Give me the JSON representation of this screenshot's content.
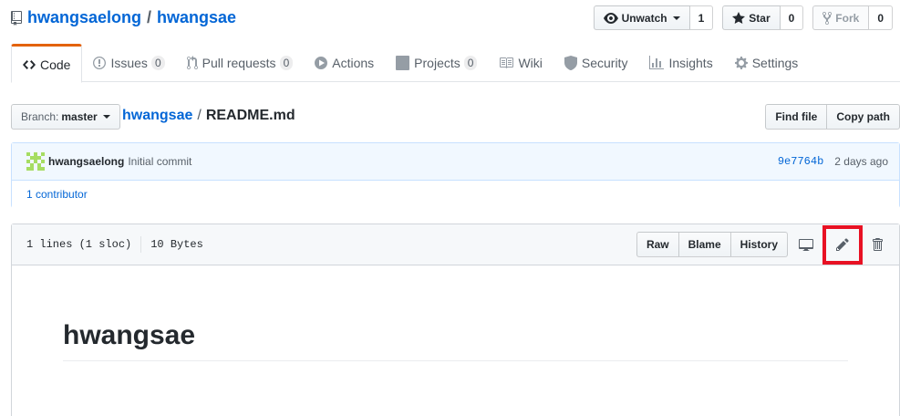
{
  "repo": {
    "owner": "hwangsaelong",
    "separator": "/",
    "name": "hwangsae"
  },
  "actions": {
    "watch": {
      "label": "Unwatch",
      "count": "1"
    },
    "star": {
      "label": "Star",
      "count": "0"
    },
    "fork": {
      "label": "Fork",
      "count": "0"
    }
  },
  "tabs": [
    {
      "label": "Code",
      "icon": "code-icon",
      "counter": null,
      "selected": true
    },
    {
      "label": "Issues",
      "icon": "issue-icon",
      "counter": "0"
    },
    {
      "label": "Pull requests",
      "icon": "pull-request-icon",
      "counter": "0"
    },
    {
      "label": "Actions",
      "icon": "play-icon",
      "counter": null
    },
    {
      "label": "Projects",
      "icon": "project-icon",
      "counter": "0"
    },
    {
      "label": "Wiki",
      "icon": "book-icon",
      "counter": null
    },
    {
      "label": "Security",
      "icon": "shield-icon",
      "counter": null
    },
    {
      "label": "Insights",
      "icon": "graph-icon",
      "counter": null
    },
    {
      "label": "Settings",
      "icon": "gear-icon",
      "counter": null
    }
  ],
  "file_nav": {
    "branch_prefix": "Branch:",
    "branch": "master",
    "breadcrumb_repo": "hwangsae",
    "breadcrumb_sep": "/",
    "breadcrumb_file": "README.md",
    "find_file": "Find file",
    "copy_path": "Copy path"
  },
  "commit": {
    "author": "hwangsaelong",
    "message": "Initial commit",
    "sha": "9e7764b",
    "time": "2 days ago",
    "contributors": "1 contributor"
  },
  "file": {
    "lines": "1 lines (1 sloc)",
    "size": "10 Bytes",
    "raw": "Raw",
    "blame": "Blame",
    "history": "History"
  },
  "readme": {
    "heading": "hwangsae"
  },
  "colors": {
    "link": "#0366d6",
    "tab_accent": "#e36209",
    "highlight": "#e81123",
    "identicon": "#a6dd62"
  }
}
